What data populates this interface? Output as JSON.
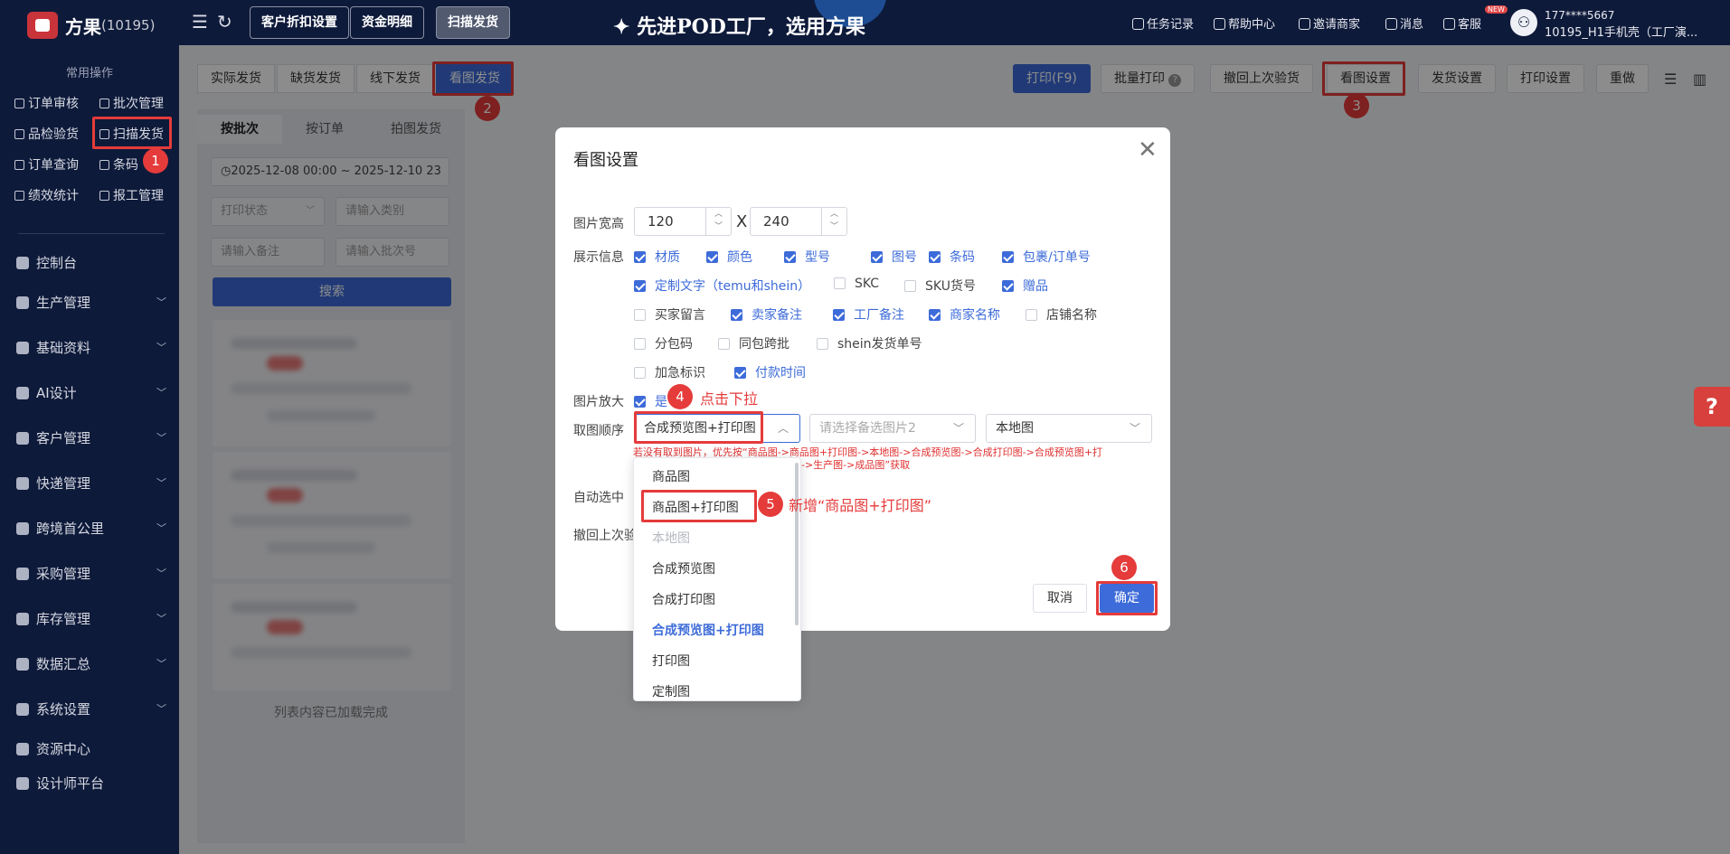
{
  "topbar": {
    "logo_text": "方果",
    "logo_id": "(10195)",
    "buttons": [
      "客户折扣设置",
      "资金明细",
      "扫描发货"
    ],
    "banner": "✦ 先进POD工厂，选用方果",
    "right_items": [
      "任务记录",
      "帮助中心",
      "邀请商家",
      "消息",
      "客服"
    ],
    "new_badge": "NEW",
    "user_phone": "177****5667",
    "user_shop": "10195_H1手机壳（工厂演..."
  },
  "sidebar": {
    "common_title": "常用操作",
    "quick_links": [
      "订单审核",
      "批次管理",
      "品检验货",
      "扫描发货",
      "订单查询",
      "条码",
      "绩效统计",
      "报工管理"
    ],
    "menu": [
      "控制台",
      "生产管理",
      "基础资料",
      "AI设计",
      "客户管理",
      "快递管理",
      "跨境首公里",
      "采购管理",
      "库存管理",
      "数据汇总",
      "系统设置",
      "资源中心",
      "设计师平台"
    ]
  },
  "content": {
    "tabs": [
      "实际发货",
      "缺货发货",
      "线下发货",
      "看图发货"
    ],
    "right_buttons": [
      "打印(F9)",
      "批量打印",
      "撤回上次验货",
      "看图设置",
      "发货设置",
      "打印设置",
      "重做"
    ],
    "panel_tabs": [
      "按批次",
      "按订单",
      "拍图发货"
    ],
    "date_range": "2025-12-08 00:00 ~ 2025-12-10 23",
    "print_status": "打印状态",
    "category_placeholder": "请输入类别",
    "remark_placeholder": "请输入备注",
    "batch_placeholder": "请输入批次号",
    "search": "搜索",
    "list_done": "列表内容已加载完成"
  },
  "modal": {
    "title": "看图设置",
    "size_label": "图片宽高",
    "width": "120",
    "height": "240",
    "x": "X",
    "display_label": "展示信息",
    "options": [
      {
        "label": "材质",
        "checked": true
      },
      {
        "label": "颜色",
        "checked": true
      },
      {
        "label": "型号",
        "checked": true
      },
      {
        "label": "图号",
        "checked": true
      },
      {
        "label": "条码",
        "checked": true
      },
      {
        "label": "包裹/订单号",
        "checked": true
      },
      {
        "label": "定制文字（temu和shein）",
        "checked": true
      },
      {
        "label": "SKC",
        "checked": false
      },
      {
        "label": "SKU货号",
        "checked": false
      },
      {
        "label": "赠品",
        "checked": true
      },
      {
        "label": "买家留言",
        "checked": false
      },
      {
        "label": "卖家备注",
        "checked": true
      },
      {
        "label": "工厂备注",
        "checked": true
      },
      {
        "label": "商家名称",
        "checked": true
      },
      {
        "label": "店铺名称",
        "checked": false
      },
      {
        "label": "分包码",
        "checked": false
      },
      {
        "label": "同包跨批",
        "checked": false
      },
      {
        "label": "shein发货单号",
        "checked": false
      },
      {
        "label": "加急标识",
        "checked": false
      },
      {
        "label": "付款时间",
        "checked": true
      }
    ],
    "zoom_label": "图片放大",
    "zoom_yes": "是",
    "order_label": "取图顺序",
    "order_selected": "合成预览图+打印图",
    "order_placeholder2": "请选择备选图片2",
    "order_select3": "本地图",
    "hint_line1": "若没有取到图片，优先按“商品图->商品图+打印图->本地图->合成预览图->合成打印图->合成预览图+打",
    "hint_line2": "->生产图->成品图”获取",
    "auto_select_label": "自动选中",
    "withdraw_label": "撤回上次验",
    "dropdown": [
      "商品图",
      "商品图+打印图",
      "本地图",
      "合成预览图",
      "合成打印图",
      "合成预览图+打印图",
      "打印图",
      "定制图"
    ],
    "cancel": "取消",
    "ok": "确定"
  },
  "annotations": {
    "a1": "1",
    "a2": "2",
    "a3": "3",
    "a4": "4",
    "a5": "5",
    "a6": "6",
    "t4": "点击下拉",
    "t5": "新增“商品图+打印图”"
  },
  "help_float": "?",
  "colors": {
    "primary": "#3d6bd9",
    "annotation": "#e53b3b",
    "nav": "#0e1a3a"
  }
}
